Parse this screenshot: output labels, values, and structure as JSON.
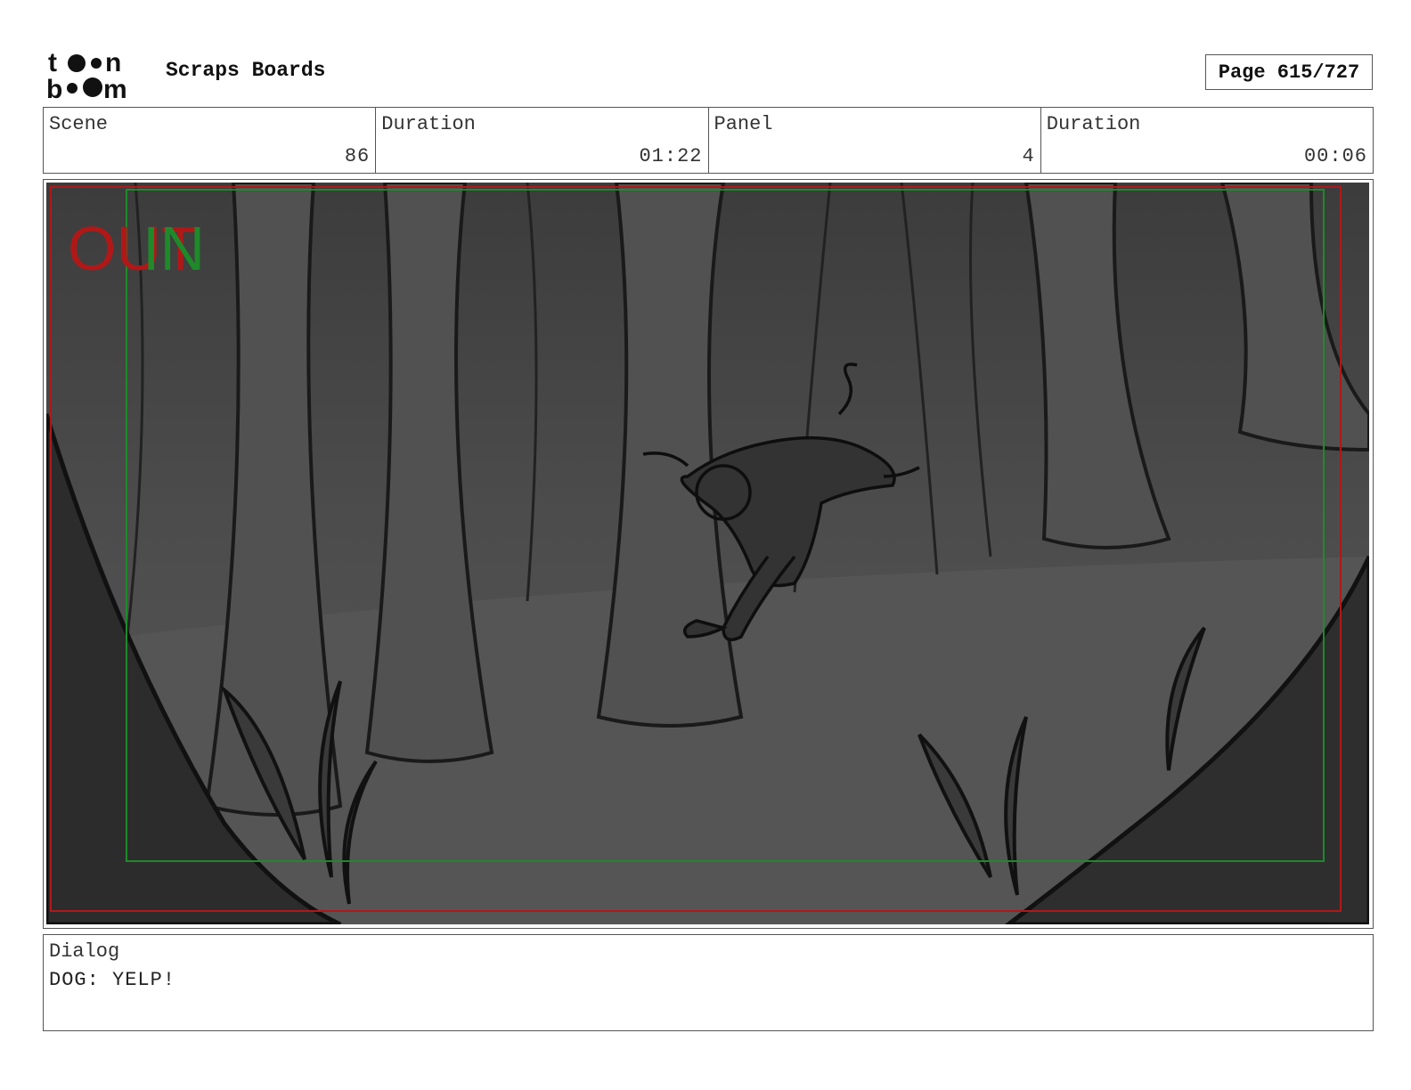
{
  "header": {
    "logo_text_top": "toon",
    "logo_text_bottom": "boom",
    "project_title": "Scraps Boards",
    "page_label": "Page 615/727"
  },
  "info": [
    {
      "label": "Scene",
      "value": "86"
    },
    {
      "label": "Duration",
      "value": "01:22"
    },
    {
      "label": "Panel",
      "value": "4"
    },
    {
      "label": "Duration",
      "value": "00:06"
    }
  ],
  "panel": {
    "overlay_out": "OUT",
    "overlay_in": "IN",
    "colors": {
      "out_frame": "#b01818",
      "in_frame": "#1e8a2a",
      "background": "#4a4a4a"
    }
  },
  "dialog": {
    "label": "Dialog",
    "text": "DOG: YELP!"
  }
}
